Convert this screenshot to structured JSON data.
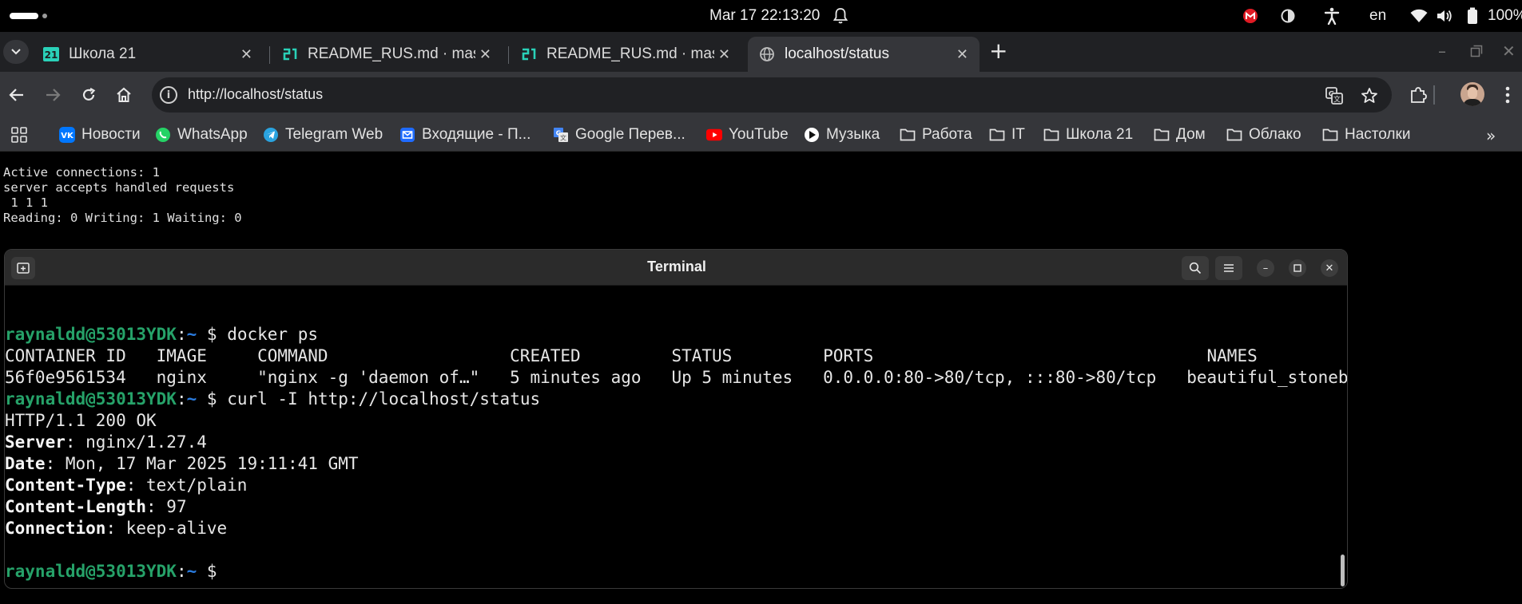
{
  "topbar": {
    "clock": "Mar 17  22:13:20",
    "language": "en",
    "battery": "100%",
    "colors": {
      "recording": "#e01b24"
    }
  },
  "tabs": [
    {
      "title": "Школа 21",
      "favicon": "school21-icon",
      "active": false
    },
    {
      "title": "README_RUS.md · master",
      "favicon": "school21-icon",
      "active": false
    },
    {
      "title": "README_RUS.md · master",
      "favicon": "school21-icon",
      "active": false
    },
    {
      "title": "localhost/status",
      "favicon": "globe-icon",
      "active": true
    }
  ],
  "toolbar": {
    "url": "http://localhost/status"
  },
  "bookmarks": [
    {
      "label": "Новости",
      "icon": "vk-icon"
    },
    {
      "label": "WhatsApp",
      "icon": "whatsapp-icon"
    },
    {
      "label": "Telegram Web",
      "icon": "telegram-icon"
    },
    {
      "label": "Входящие - П...",
      "icon": "mail-icon"
    },
    {
      "label": "Google Перев...",
      "icon": "translate-icon"
    },
    {
      "label": "YouTube",
      "icon": "youtube-icon"
    },
    {
      "label": "Музыка",
      "icon": "music-icon"
    },
    {
      "label": "Работа",
      "icon": "folder-icon"
    },
    {
      "label": "IT",
      "icon": "folder-icon"
    },
    {
      "label": "Школа 21",
      "icon": "folder-icon"
    },
    {
      "label": "Дом",
      "icon": "folder-icon"
    },
    {
      "label": "Облако",
      "icon": "folder-icon"
    },
    {
      "label": "Настолки",
      "icon": "folder-icon"
    }
  ],
  "page": {
    "status_lines": [
      "Active connections: 1",
      "server accepts handled requests",
      " 1 1 1",
      "Reading: 0 Writing: 1 Waiting: 0"
    ]
  },
  "terminal": {
    "title": "Terminal",
    "prompt_user": "raynaldd@53013YDK",
    "prompt_sep": ":",
    "prompt_path": "~",
    "prompt_dollar": " $ ",
    "cmd1": "docker ps",
    "ps_header": "CONTAINER ID   IMAGE     COMMAND                  CREATED         STATUS         PORTS                                 NAMES",
    "ps_row": "56f0e9561534   nginx     \"nginx -g 'daemon of…\"   5 minutes ago   Up 5 minutes   0.0.0.0:80->80/tcp, :::80->80/tcp   beautiful_stonebraker",
    "cmd2": "curl -I http://localhost/status",
    "http_status": "HTTP/1.1 200 OK",
    "headers": [
      {
        "key": "Server",
        "value": ": nginx/1.27.4"
      },
      {
        "key": "Date",
        "value": ": Mon, 17 Mar 2025 19:11:41 GMT"
      },
      {
        "key": "Content-Type",
        "value": ": text/plain"
      },
      {
        "key": "Content-Length",
        "value": ": 97"
      },
      {
        "key": "Connection",
        "value": ": keep-alive"
      }
    ],
    "colors": {
      "user": "#26a269",
      "path": "#2a7bde"
    }
  }
}
